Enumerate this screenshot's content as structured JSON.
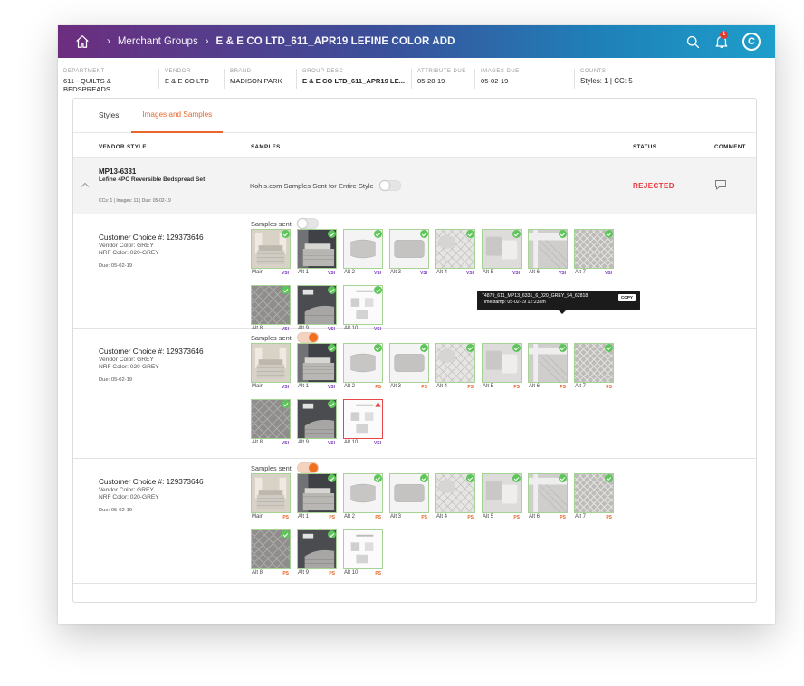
{
  "breadcrumb": {
    "items": [
      "Merchant Groups",
      "E & E CO LTD_611_APR19 LEFINE COLOR ADD"
    ],
    "separator": "›"
  },
  "header": {
    "avatar_letter": "C",
    "notification_count": "1"
  },
  "meta": [
    {
      "label": "DEPARTMENT",
      "value": "611 - QUILTS & BEDSPREADS"
    },
    {
      "label": "VENDOR",
      "value": "E & E CO LTD"
    },
    {
      "label": "BRAND",
      "value": "MADISON PARK"
    },
    {
      "label": "GROUP DESC",
      "value": "E & E CO LTD_611_APR19 LE..."
    },
    {
      "label": "ATTRIBUTE DUE",
      "value": "05-28-19"
    },
    {
      "label": "IMAGES DUE",
      "value": "05-02-19"
    },
    {
      "label": "COUNTS",
      "value": "Styles: 1 | CC: 5"
    }
  ],
  "tabs": [
    {
      "label": "Styles"
    },
    {
      "label": "Images and Samples",
      "active": true
    }
  ],
  "columns": {
    "vendor_style": "VENDOR STYLE",
    "samples": "SAMPLES",
    "status": "STATUS",
    "comment": "COMMENT"
  },
  "style_row": {
    "id": "MP13-6331",
    "desc": "Lefine 4PC Reversible Bedspread Set",
    "meta": "CCs: 1 | Images: 11 | Due: 05-02-19",
    "entire_label": "Kohls.com Samples Sent for Entire Style",
    "entire_on": false,
    "status": "REJECTED"
  },
  "tooltip": {
    "name": "74879_611_MP13_6331_6_020_GREY_94_62818",
    "timestamp": "Timestamp: 05-02-19 12:23am",
    "copy_label": "COPY"
  },
  "customer_choices": [
    {
      "title": "Customer Choice #: 129373646",
      "vendor_color": "Vendor Color: GREY",
      "nrf_color": "NRF Color: 020-GREY",
      "due": "Due: 05-02-19",
      "samples_label": "Samples sent",
      "samples_on": false,
      "thumbs": [
        {
          "cap": "Main",
          "tag": "VSI",
          "kind": "room",
          "state": "ok"
        },
        {
          "cap": "Alt 1",
          "tag": "VSI",
          "kind": "room2",
          "state": "ok"
        },
        {
          "cap": "Alt 2",
          "tag": "VSI",
          "kind": "pillow",
          "state": "ok"
        },
        {
          "cap": "Alt 3",
          "tag": "VSI",
          "kind": "long",
          "state": "ok"
        },
        {
          "cap": "Alt 4",
          "tag": "VSI",
          "kind": "quilt",
          "state": "ok"
        },
        {
          "cap": "Alt 5",
          "tag": "VSI",
          "kind": "pillow2",
          "state": "ok"
        },
        {
          "cap": "Alt 6",
          "tag": "VSI",
          "kind": "corner",
          "state": "ok"
        },
        {
          "cap": "Alt 7",
          "tag": "VSI",
          "kind": "quilt2",
          "state": "ok"
        },
        {
          "cap": "Alt 8",
          "tag": "VSI",
          "kind": "fold",
          "state": "ok"
        },
        {
          "cap": "Alt 9",
          "tag": "VSI",
          "kind": "dark",
          "state": "ok"
        },
        {
          "cap": "Alt 10",
          "tag": "VSI",
          "kind": "doc",
          "state": "ok"
        }
      ]
    },
    {
      "title": "Customer Choice #: 129373646",
      "vendor_color": "Vendor Color: GREY",
      "nrf_color": "NRF Color: 020-GREY",
      "due": "Due: 05-02-19",
      "samples_label": "Samples sent",
      "samples_on": true,
      "thumbs": [
        {
          "cap": "Main",
          "tag": "VSI",
          "kind": "room",
          "state": "none"
        },
        {
          "cap": "Alt 1",
          "tag": "VSI",
          "kind": "room2",
          "state": "ok"
        },
        {
          "cap": "Alt 2",
          "tag": "PS",
          "kind": "pillow",
          "state": "ok"
        },
        {
          "cap": "Alt 3",
          "tag": "PS",
          "kind": "long",
          "state": "ok"
        },
        {
          "cap": "Alt 4",
          "tag": "PS",
          "kind": "quilt",
          "state": "ok"
        },
        {
          "cap": "Alt 5",
          "tag": "PS",
          "kind": "pillow2",
          "state": "ok"
        },
        {
          "cap": "Alt 6",
          "tag": "PS",
          "kind": "corner",
          "state": "ok"
        },
        {
          "cap": "Alt 7",
          "tag": "PS",
          "kind": "quilt2",
          "state": "ok"
        },
        {
          "cap": "Alt 8",
          "tag": "VSI",
          "kind": "fold",
          "state": "ok"
        },
        {
          "cap": "Alt 9",
          "tag": "VSI",
          "kind": "dark",
          "state": "ok"
        },
        {
          "cap": "Alt 10",
          "tag": "VSI",
          "kind": "doc",
          "state": "rejected"
        }
      ]
    },
    {
      "title": "Customer Choice #: 129373646",
      "vendor_color": "Vendor Color: GREY",
      "nrf_color": "NRF Color: 020-GREY",
      "due": "Due: 05-02-19",
      "samples_label": "Samples sent",
      "samples_on": true,
      "thumbs": [
        {
          "cap": "Main",
          "tag": "PS",
          "kind": "room",
          "state": "none"
        },
        {
          "cap": "Alt 1",
          "tag": "PS",
          "kind": "room2",
          "state": "ok"
        },
        {
          "cap": "Alt 2",
          "tag": "PS",
          "kind": "pillow",
          "state": "ok"
        },
        {
          "cap": "Alt 3",
          "tag": "PS",
          "kind": "long",
          "state": "ok"
        },
        {
          "cap": "Alt 4",
          "tag": "PS",
          "kind": "quilt",
          "state": "ok"
        },
        {
          "cap": "Alt 5",
          "tag": "PS",
          "kind": "pillow2",
          "state": "ok"
        },
        {
          "cap": "Alt 6",
          "tag": "PS",
          "kind": "corner",
          "state": "ok"
        },
        {
          "cap": "Alt 7",
          "tag": "PS",
          "kind": "quilt2",
          "state": "ok"
        },
        {
          "cap": "Alt 8",
          "tag": "PS",
          "kind": "fold",
          "state": "ok"
        },
        {
          "cap": "Alt 9",
          "tag": "PS",
          "kind": "dark",
          "state": "ok"
        },
        {
          "cap": "Alt 10",
          "tag": "PS",
          "kind": "doc",
          "state": "none"
        }
      ]
    }
  ],
  "colors": {
    "accent": "#e8652b",
    "rejected": "#e8353b",
    "approved_border": "#a5d394",
    "vsi": "#7c3fbf"
  }
}
